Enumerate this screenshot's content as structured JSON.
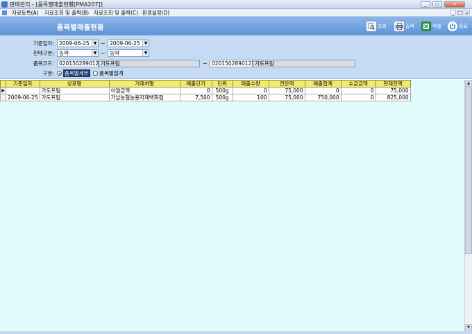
{
  "window": {
    "title": "판매관리 - [품목별매출현황[PMA207]]",
    "buttons": [
      "_",
      "□",
      "×"
    ]
  },
  "menu": {
    "items": [
      "자료등록(A)",
      "자료조회 및 출력(B)",
      "자료조회 및 출력(C)",
      "환경설정(D)"
    ],
    "mdi_buttons": [
      "_",
      "□",
      "×"
    ]
  },
  "header": {
    "page_title": "품목별매출현황",
    "toolbar": [
      {
        "label": "조회",
        "icon": "search-icon",
        "color": "#ffffff"
      },
      {
        "label": "출력",
        "icon": "printer-icon",
        "color": "#ffffff"
      },
      {
        "label": "엑셀",
        "icon": "excel-icon",
        "color": "#1e8c3a"
      },
      {
        "label": "종료",
        "icon": "power-icon",
        "color": "#2a6fd6"
      }
    ]
  },
  "filters": {
    "date_label": "기준일자:",
    "date_from": "2009-06-25",
    "date_to": "2009-06-25",
    "sales_type_label": "판매구분:",
    "sales_type_from": "농약",
    "sales_type_to": "농약",
    "item_code_label": "품목코드:",
    "item_code_from": "0201502890123",
    "item_name_from": "가도프림",
    "item_code_to": "0201502890123",
    "item_name_to": "가도프림",
    "tilde": "~",
    "mode_label": "구분:",
    "mode_options": [
      {
        "label": "품목별세부",
        "selected": true
      },
      {
        "label": "품목별집계",
        "selected": false
      }
    ]
  },
  "grid": {
    "columns": [
      "기준일자",
      "상표명",
      "거래처명",
      "매출단가",
      "단위",
      "매출수량",
      "전잔액",
      "매출합계",
      "수금금액",
      "현재잔액"
    ],
    "rows": [
      [
        "",
        "가도프림",
        "이월금액",
        "0",
        "500g",
        "0",
        "75,000",
        "0",
        "0",
        "75,000"
      ],
      [
        "2009-06-25",
        "가도프림",
        "가남농협농용자재백화점",
        "7,500",
        "500g",
        "100",
        "75,000",
        "750,000",
        "0",
        "825,000"
      ]
    ]
  },
  "colors": {
    "header_band": "#6fa2dd",
    "filter_panel": "#c4dbf3",
    "grid_header": "#f3ec6a",
    "grid_background": "#e4fbfd"
  }
}
